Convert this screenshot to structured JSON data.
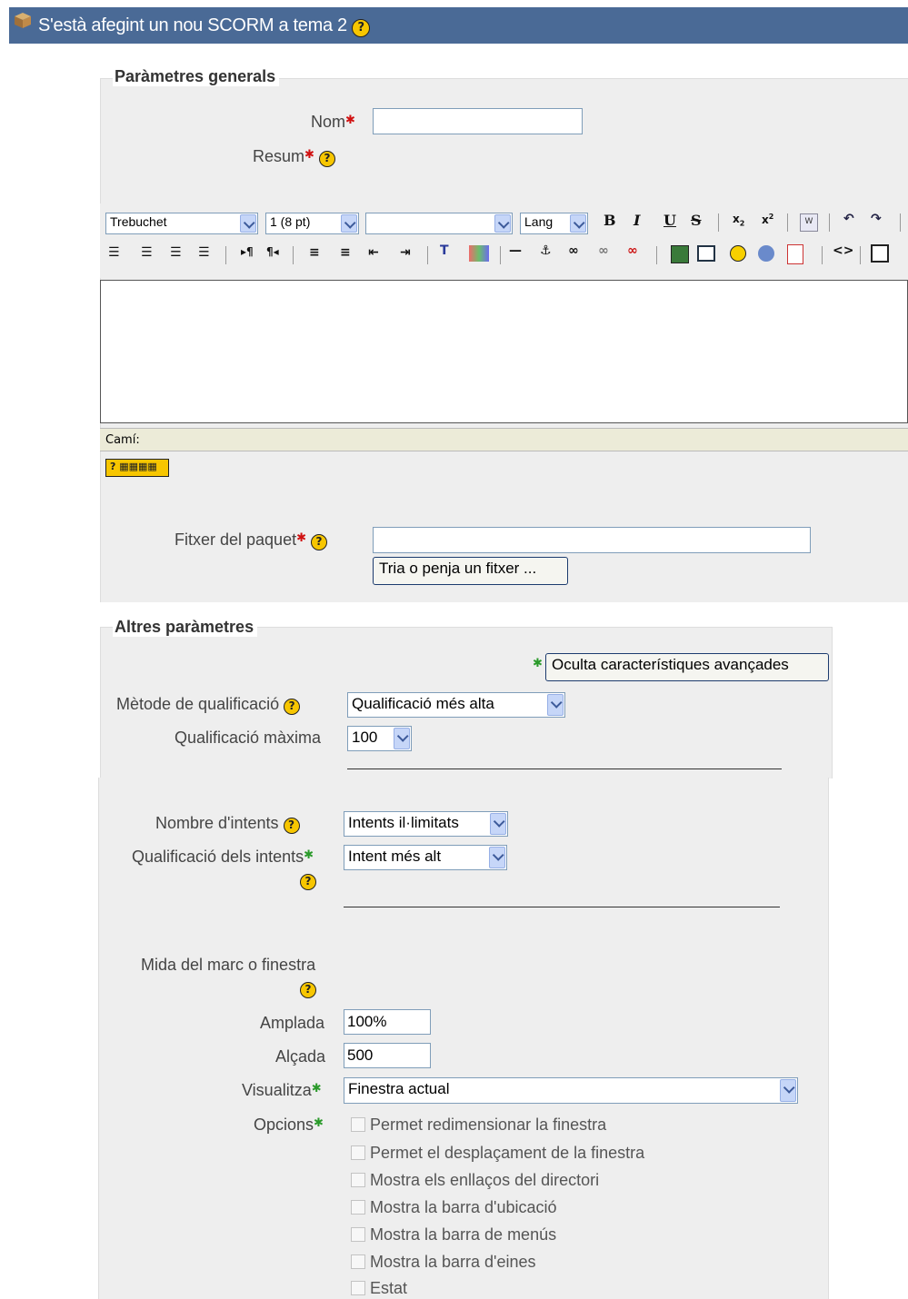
{
  "header": {
    "title": "S'està afegint un nou SCORM a tema 2"
  },
  "general": {
    "legend": "Paràmetres generals",
    "name_label": "Nom",
    "name_value": "",
    "summary_label": "Resum",
    "editor": {
      "font": "Trebuchet",
      "size": "1 (8 pt)",
      "style": "",
      "lang": "Lang",
      "path_label": "Camí:"
    },
    "package_label": "Fitxer del paquet",
    "package_value": "",
    "choose_button": "Tria o penja un fitxer ..."
  },
  "other": {
    "legend": "Altres paràmetres",
    "advanced_button": "Oculta característiques avançades",
    "grading_method_label": "Mètode de qualificació",
    "grading_method_value": "Qualificació més alta",
    "max_grade_label": "Qualificació màxima",
    "max_grade_value": "100",
    "attempts_label": "Nombre d'intents",
    "attempts_value": "Intents il·limitats",
    "attempt_grading_label": "Qualificació dels intents",
    "attempt_grading_value": "Intent més alt",
    "frame_size_label": "Mida del marc o finestra",
    "width_label": "Amplada",
    "width_value": "100%",
    "height_label": "Alçada",
    "height_value": "500",
    "display_label": "Visualitza",
    "display_value": "Finestra actual",
    "options_label": "Opcions",
    "options": [
      "Permet redimensionar la finestra",
      "Permet el desplaçament de la finestra",
      "Mostra els enllaços del directori",
      "Mostra la barra d'ubicació",
      "Mostra la barra de menús",
      "Mostra la barra d'eines",
      "Estat"
    ]
  }
}
